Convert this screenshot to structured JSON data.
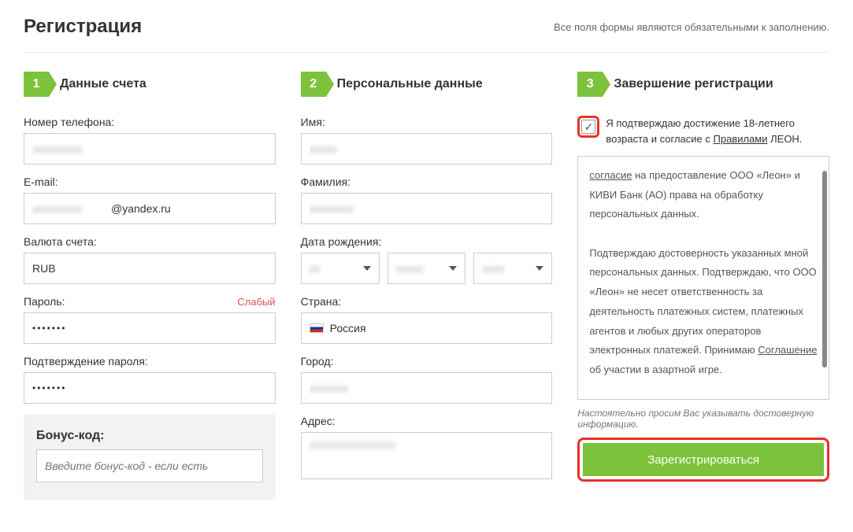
{
  "header": {
    "title": "Регистрация",
    "hint": "Все поля формы являются обязательными к заполнению."
  },
  "steps": {
    "s1": {
      "num": "1",
      "title": "Данные счета"
    },
    "s2": {
      "num": "2",
      "title": "Персональные данные"
    },
    "s3": {
      "num": "3",
      "title": "Завершение регистрации"
    }
  },
  "col1": {
    "phone_label": "Номер телефона:",
    "email_label": "E-mail:",
    "email_domain": "@yandex.ru",
    "currency_label": "Валюта счета:",
    "currency_value": "RUB",
    "password_label": "Пароль:",
    "password_strength": "Слабый",
    "password_confirm_label": "Подтверждение пароля:",
    "password_masked": "•••••••",
    "bonus_label": "Бонус-код:",
    "bonus_placeholder": "Введите бонус-код - если есть"
  },
  "col2": {
    "firstname_label": "Имя:",
    "lastname_label": "Фамилия:",
    "birthdate_label": "Дата рождения:",
    "country_label": "Страна:",
    "country_value": "Россия",
    "city_label": "Город:",
    "address_label": "Адрес:"
  },
  "col3": {
    "agree_prefix": "Я подтверждаю достижение 18-летнего возраста и согласие с ",
    "agree_rules": "Правилами",
    "agree_suffix": " ЛЕОН.",
    "terms_p1_a": "согласие",
    "terms_p1_b": " на предоставление ООО «Леон» и КИВИ Банк (АО) права на обработку персональных данных.",
    "terms_p2_a": "Подтверждаю достоверность указанных мной персональных данных. Подтверждаю, что ООО «Леон» не несет ответственность за деятельность платежных систем, платежных агентов и любых других операторов электронных платежей. Принимаю ",
    "terms_p2_link": "Соглашение",
    "terms_p2_b": " об участии в азартной игре.",
    "disclaimer": "Настоятельно просим Вас указывать достоверную информацию.",
    "submit": "Зарегистрироваться"
  }
}
